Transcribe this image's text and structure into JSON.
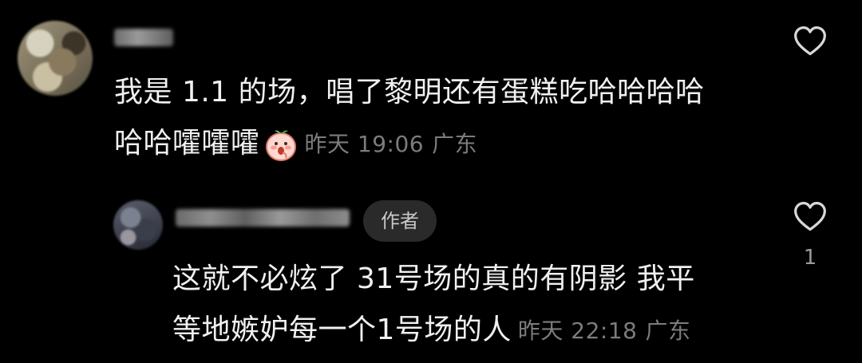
{
  "comments": [
    {
      "line1": "我是 1.1 的场，唱了黎明还有蛋糕吃哈哈哈哈",
      "line2": "哈哈嚯嚯嚯",
      "emoji": "peach-face-emoji",
      "time": "昨天 19:06",
      "location": "广东",
      "like_icon": "heart-outline-icon",
      "like_count": ""
    },
    {
      "author_badge": "作者",
      "line1": "这就不必炫了 31号场的真的有阴影 我平",
      "line2": "等地嫉妒每一个1号场的人",
      "time": "昨天 22:18",
      "location": "广东",
      "like_icon": "heart-outline-icon",
      "like_count": "1"
    }
  ],
  "colors": {
    "background": "#000000",
    "text": "#f0f0f0",
    "meta": "#7c7c7c",
    "badge_bg": "#2a2a2a"
  }
}
